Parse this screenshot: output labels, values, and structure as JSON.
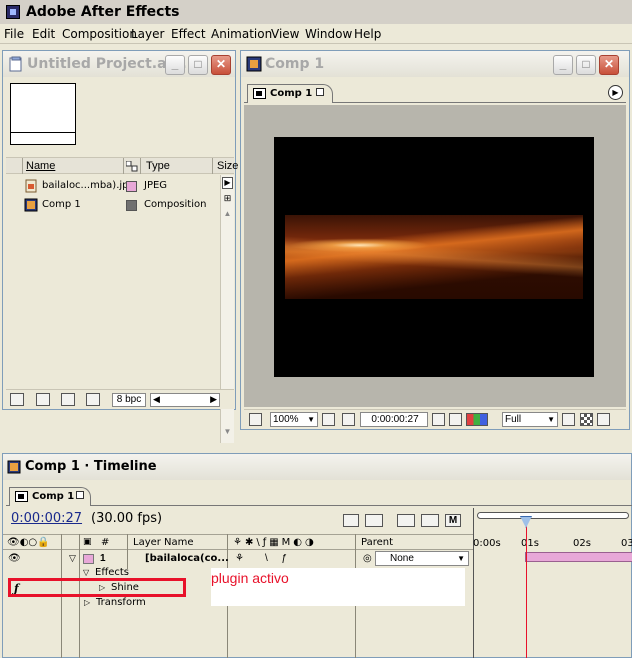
{
  "app": {
    "title": "Adobe After Effects"
  },
  "menu": [
    "File",
    "Edit",
    "Composition",
    "Layer",
    "Effect",
    "Animation",
    "View",
    "Window",
    "Help"
  ],
  "project": {
    "window_title": "Untitled Project.ae...",
    "columns": {
      "name": "Name",
      "type": "Type",
      "size": "Size"
    },
    "items": [
      {
        "name": "bailaloc...mba).jpg",
        "type": "JPEG",
        "swatch": "#e8a8d8",
        "icon": "image-file-icon"
      },
      {
        "name": "Comp 1",
        "type": "Composition",
        "swatch": "#707070",
        "icon": "composition-icon"
      }
    ],
    "bpc": "8 bpc"
  },
  "comp": {
    "window_title": "Comp 1",
    "tab_label": "Comp 1",
    "zoom": "100%",
    "timecode": "0:00:00:27",
    "resolution": "Full"
  },
  "timeline": {
    "window_title": "Comp 1 · Timeline",
    "tab_label": "Comp 1",
    "current_time": "0:00:00:27",
    "fps": "(30.00 fps)",
    "columns": {
      "number": "#",
      "layer_name": "Layer Name",
      "parent": "Parent"
    },
    "layer": {
      "number": "1",
      "name": "[bailaloca(co...",
      "parent": "None",
      "color": "#e8a8d8"
    },
    "effects_label": "Effects",
    "effect_name": "Shine",
    "transform_label": "Transform",
    "annotation": "plugin activo",
    "ruler": [
      "0:00s",
      "01s",
      "02s",
      "03"
    ]
  }
}
